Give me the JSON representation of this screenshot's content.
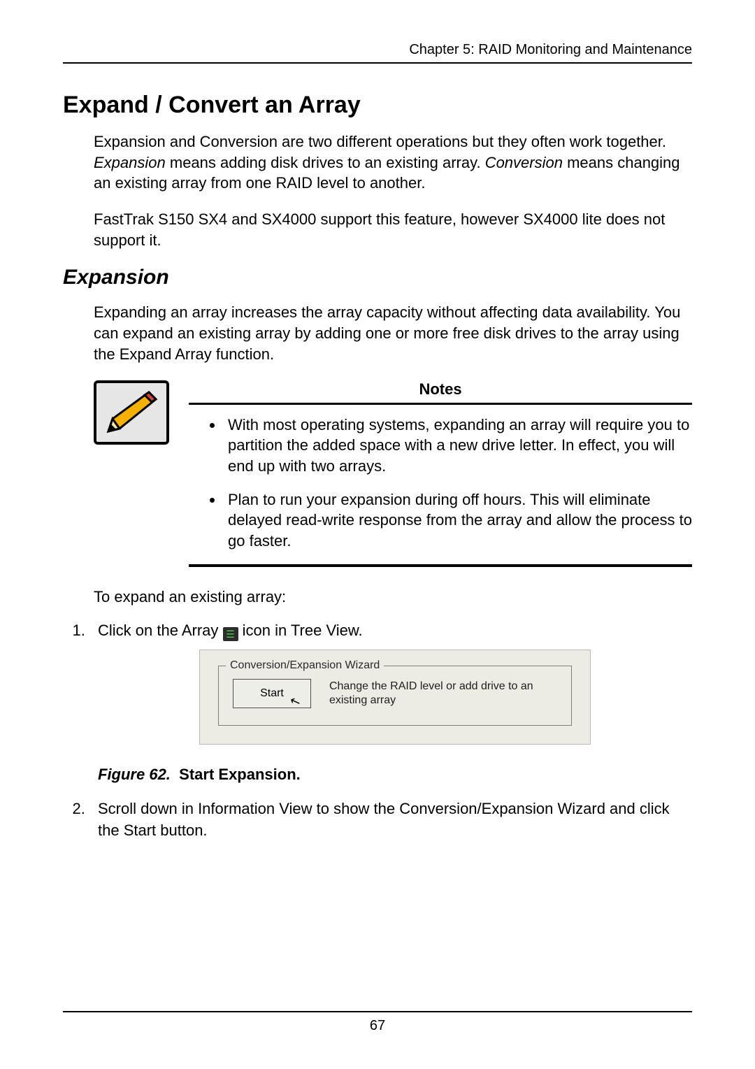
{
  "page": {
    "running_head": "Chapter 5: RAID Monitoring and Maintenance",
    "number": "67"
  },
  "section": {
    "title": "Expand / Convert an Array",
    "para1_pre": "Expansion and Conversion are two different operations but they often work together. ",
    "term_expansion": "Expansion",
    "para1_mid": " means adding disk drives to an existing array. ",
    "term_conversion": "Conversion",
    "para1_post": " means changing an existing array from one RAID level to another.",
    "para2": "FastTrak S150 SX4 and SX4000 support this feature, however SX4000 lite does not support it."
  },
  "subsection": {
    "title": "Expansion",
    "para": "Expanding an array increases the array capacity without affecting data availability. You can expand an existing array by adding one or more free disk drives to the array using the Expand Array function."
  },
  "notes": {
    "title": "Notes",
    "items": [
      "With most operating systems, expanding an array will require you to partition the added space with a new drive letter. In effect, you will end up with two arrays.",
      "Plan to run your expansion during off hours. This will eliminate delayed read-write response from the array and allow the process to go faster."
    ]
  },
  "steps": {
    "lead_in": "To expand an existing array:",
    "item1_pre": "Click on the Array ",
    "item1_post": " icon in Tree View.",
    "item2": "Scroll down in Information View to show the Conversion/Expansion Wizard and click the Start button."
  },
  "wizard": {
    "legend": "Conversion/Expansion Wizard",
    "button": "Start",
    "text": "Change the RAID level or add drive to an existing array"
  },
  "figure": {
    "label": "Figure 62.",
    "title": "Start Expansion."
  },
  "icons": {
    "pencil_title": "pencil-note-icon",
    "array_title": "array-icon"
  }
}
